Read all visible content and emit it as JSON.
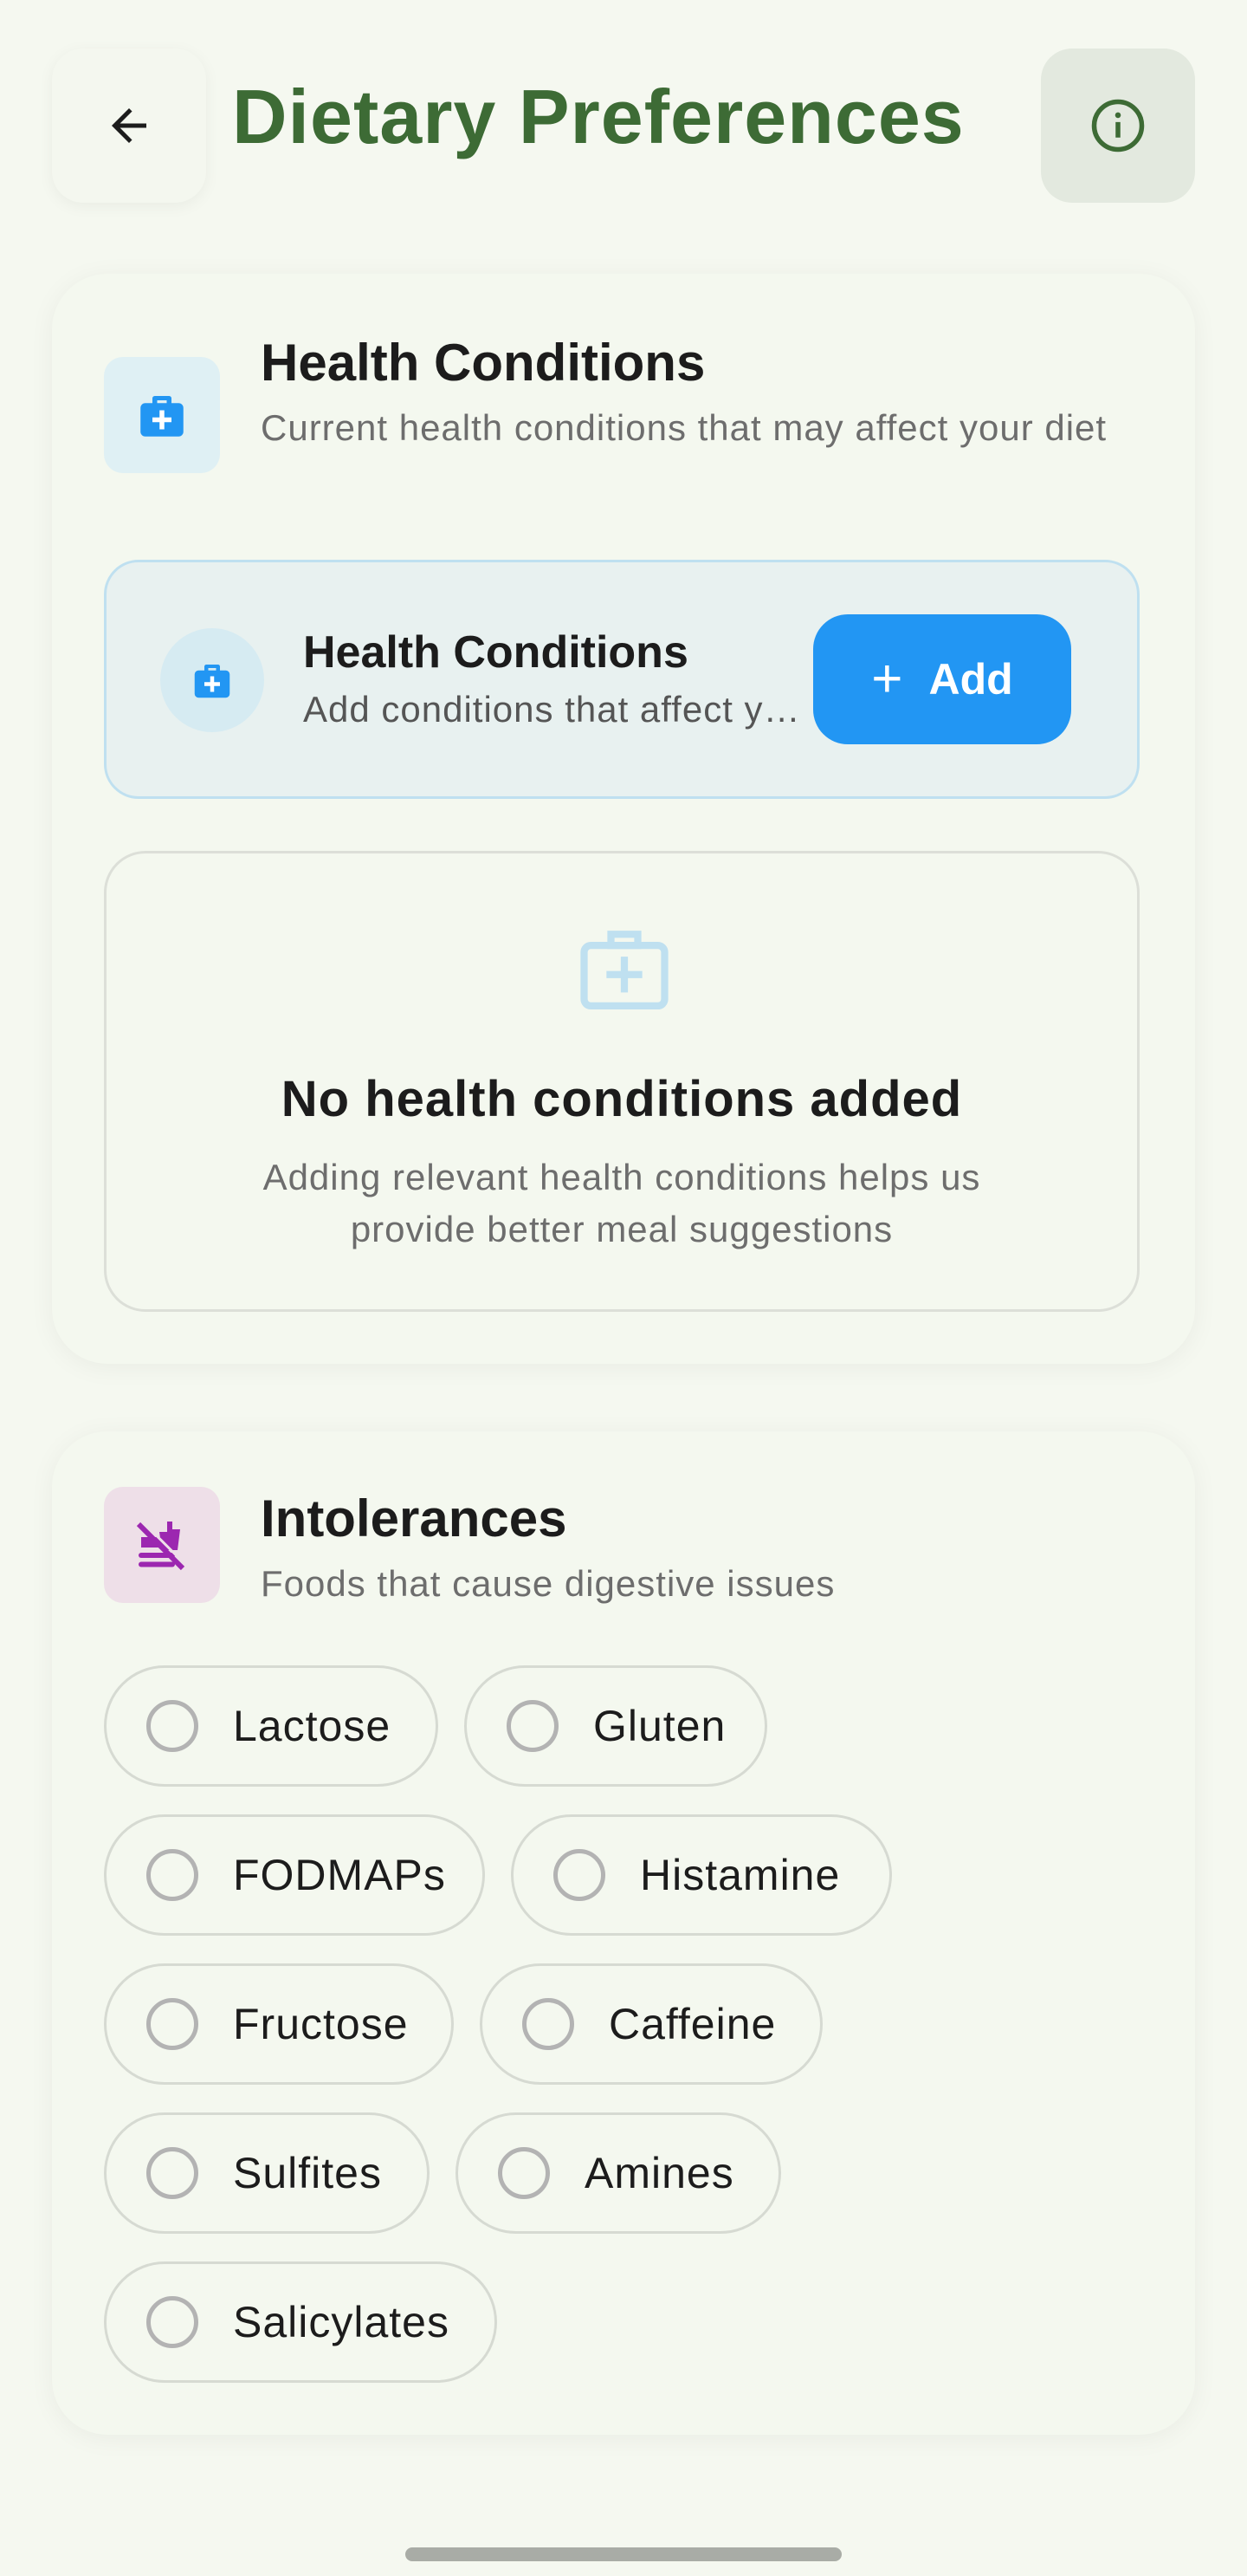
{
  "header": {
    "title": "Dietary Preferences",
    "back_icon": "arrow-left-icon",
    "info_icon": "info-icon"
  },
  "health_section": {
    "title": "Health Conditions",
    "subtitle": "Current health conditions that may affect your diet",
    "icon": "medical-bag-icon",
    "row": {
      "title": "Health Conditions",
      "subtitle": "Add conditions that affect your diet",
      "add_label": "Add"
    },
    "empty": {
      "title": "No health conditions added",
      "subtitle": "Adding relevant health conditions helps us provide better meal suggestions"
    }
  },
  "intolerances_section": {
    "title": "Intolerances",
    "subtitle": "Foods that cause digestive issues",
    "icon": "no-food-icon",
    "options": [
      {
        "label": "Lactose",
        "selected": false
      },
      {
        "label": "Gluten",
        "selected": false
      },
      {
        "label": "FODMAPs",
        "selected": false
      },
      {
        "label": "Histamine",
        "selected": false
      },
      {
        "label": "Fructose",
        "selected": false
      },
      {
        "label": "Caffeine",
        "selected": false
      },
      {
        "label": "Sulfites",
        "selected": false
      },
      {
        "label": "Amines",
        "selected": false
      },
      {
        "label": "Salicylates",
        "selected": false
      }
    ]
  },
  "colors": {
    "accent_green": "#3d6b35",
    "accent_blue": "#2296f3",
    "intolerance_purple": "#9c27b0"
  }
}
